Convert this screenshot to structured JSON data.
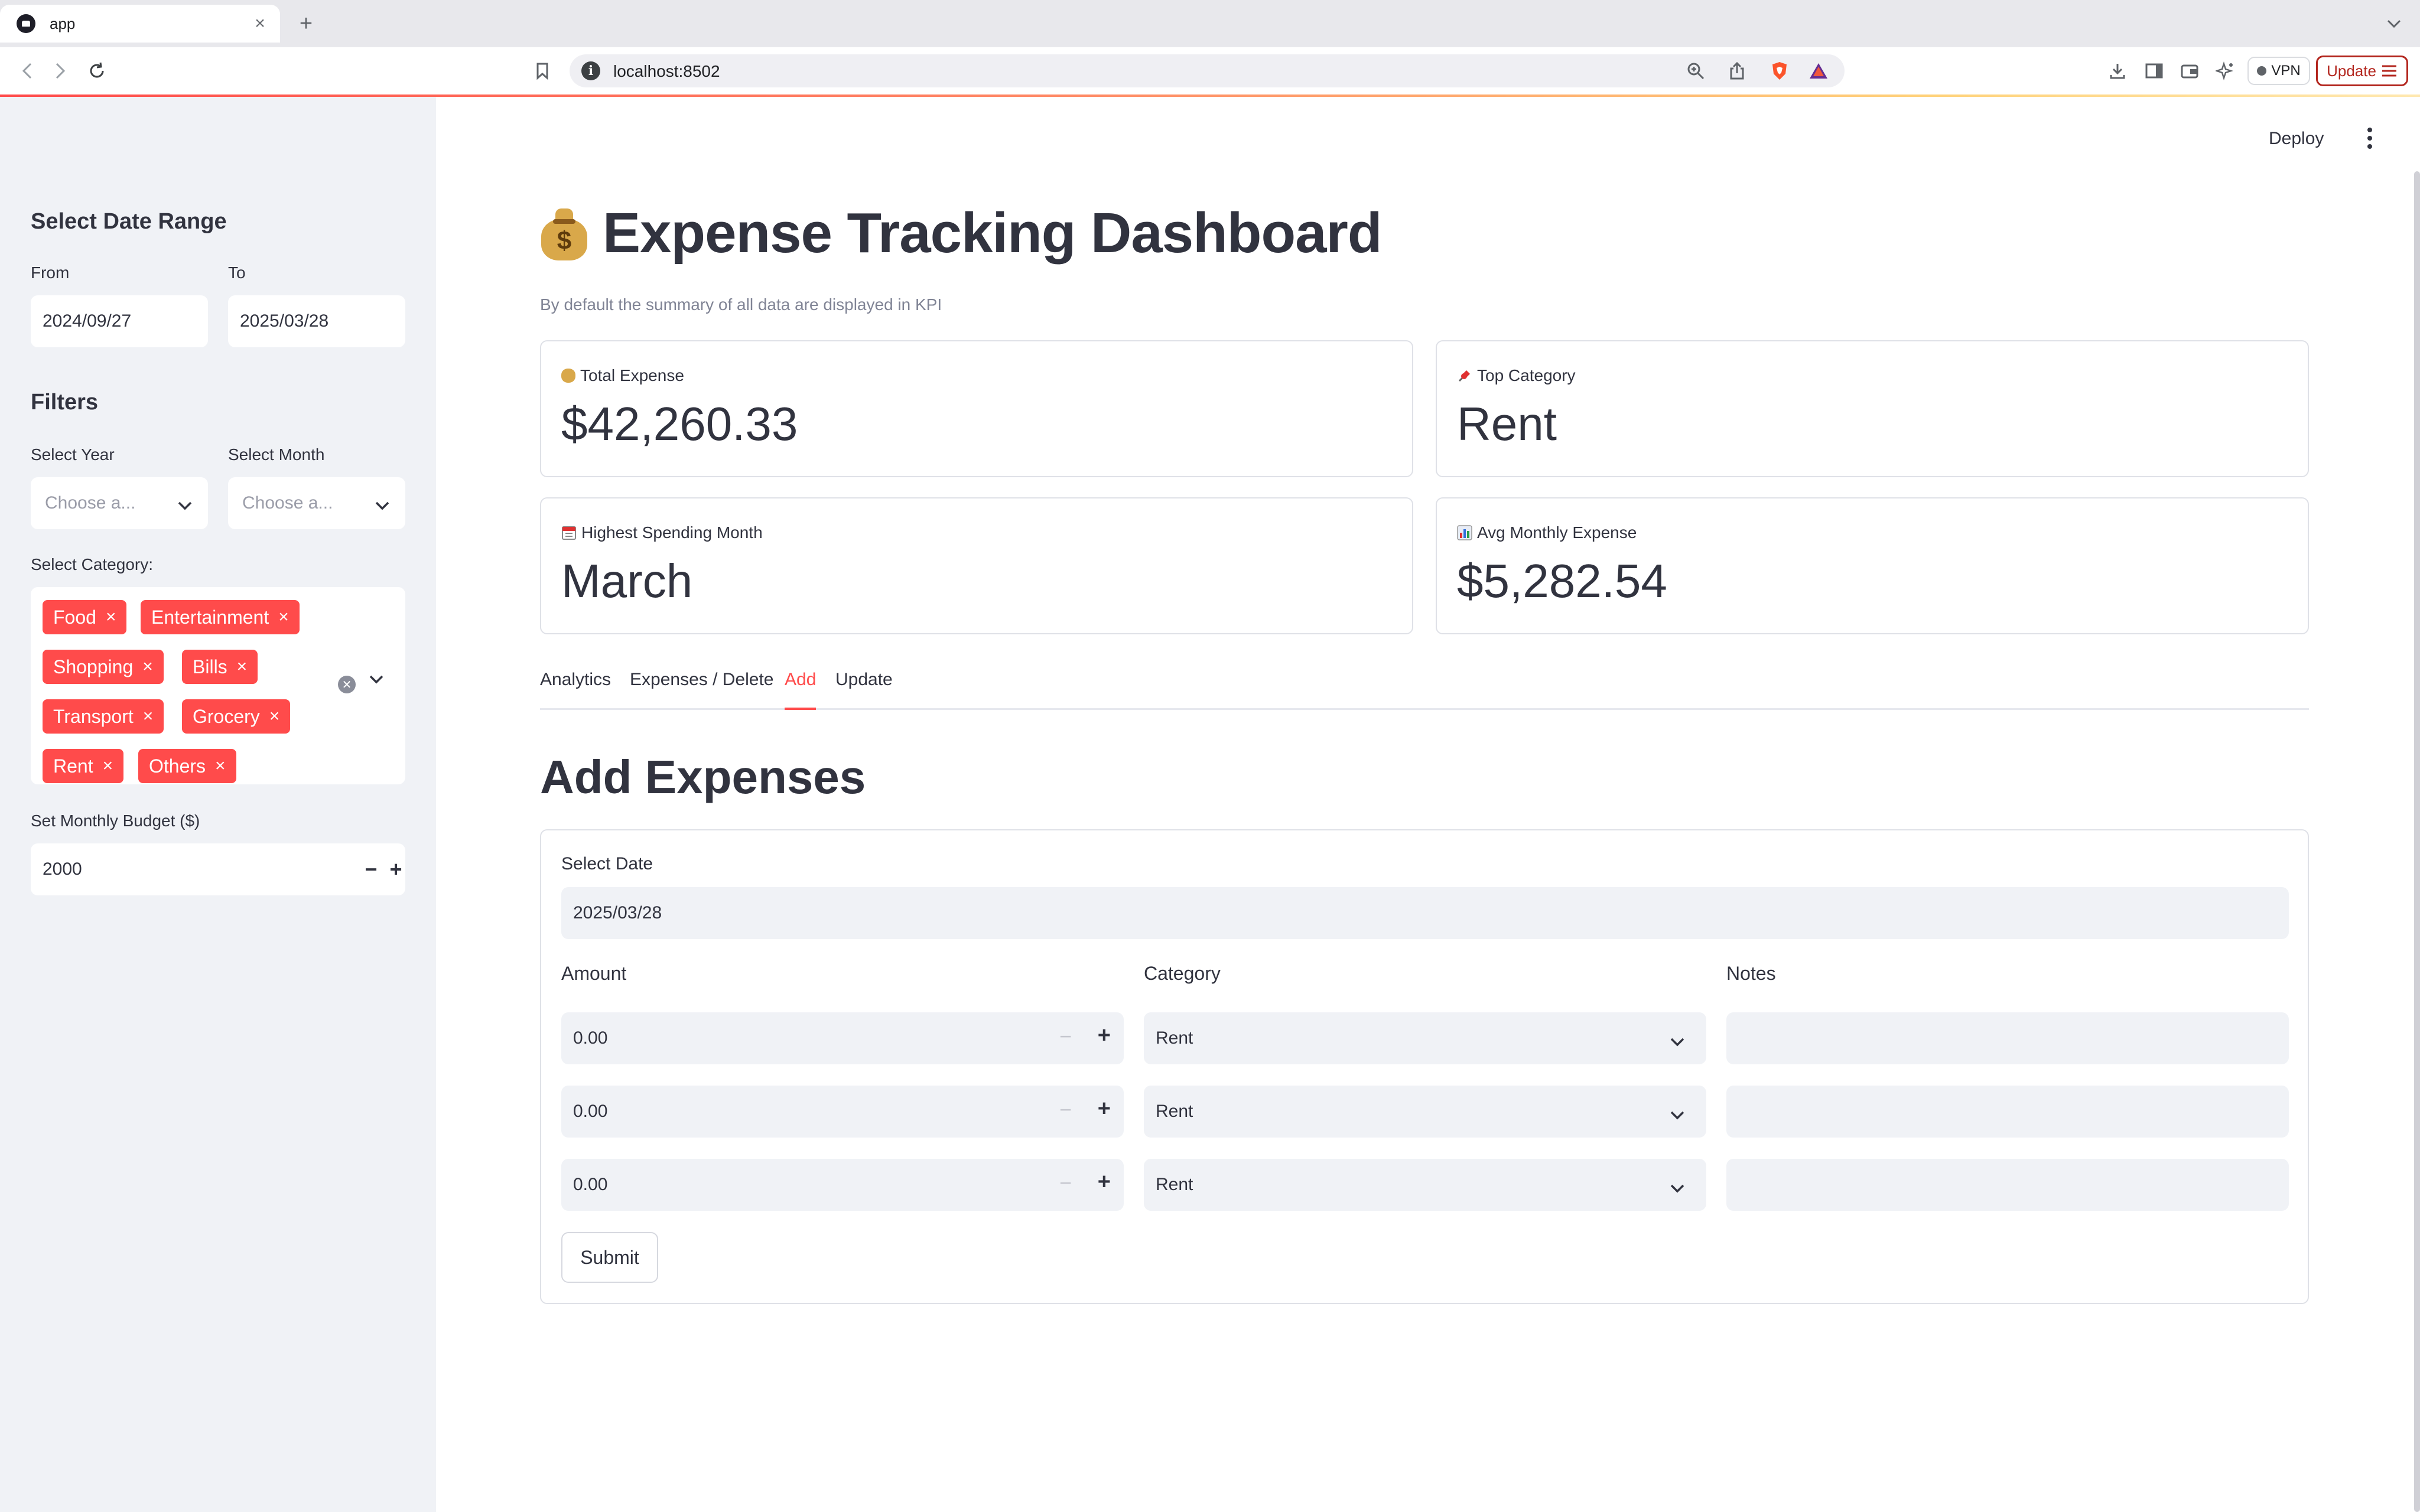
{
  "browser": {
    "tab_title": "app",
    "tab_close": "×",
    "new_tab": "+",
    "url": "localhost:8502",
    "vpn_label": "VPN",
    "update_label": "Update"
  },
  "sidebar": {
    "date_range_heading": "Select Date Range",
    "from_label": "From",
    "from_value": "2024/09/27",
    "to_label": "To",
    "to_value": "2025/03/28",
    "filters_heading": "Filters",
    "year_label": "Select Year",
    "year_placeholder": "Choose a...",
    "month_label": "Select Month",
    "month_placeholder": "Choose a...",
    "category_label": "Select Category:",
    "categories": [
      "Food",
      "Entertainment",
      "Shopping",
      "Bills",
      "Transport",
      "Grocery",
      "Rent",
      "Others"
    ],
    "chip_remove": "×",
    "budget_label": "Set Monthly Budget ($)",
    "budget_value": "2000",
    "minus": "−",
    "plus": "+"
  },
  "header": {
    "deploy_label": "Deploy"
  },
  "main": {
    "title": "Expense Tracking Dashboard",
    "caption": "By default the summary of all data are displayed in KPI",
    "kpis": [
      {
        "label": "Total Expense",
        "value": "$42,260.33",
        "icon": "money-bag-icon"
      },
      {
        "label": "Top Category",
        "value": "Rent",
        "icon": "pushpin-icon"
      },
      {
        "label": "Highest Spending Month",
        "value": "March",
        "icon": "calendar-icon"
      },
      {
        "label": "Avg Monthly Expense",
        "value": "$5,282.54",
        "icon": "bar-chart-icon"
      }
    ],
    "tabs": [
      "Analytics",
      "Expenses / Delete",
      "Add",
      "Update"
    ],
    "active_tab": "Add",
    "section_title": "Add Expenses",
    "form": {
      "date_label": "Select Date",
      "date_value": "2025/03/28",
      "amount_label": "Amount",
      "category_label": "Category",
      "notes_label": "Notes",
      "rows": [
        {
          "amount": "0.00",
          "category": "Rent",
          "notes": ""
        },
        {
          "amount": "0.00",
          "category": "Rent",
          "notes": ""
        },
        {
          "amount": "0.00",
          "category": "Rent",
          "notes": ""
        }
      ],
      "submit_label": "Submit"
    }
  },
  "colors": {
    "accent": "#ff4b4b",
    "sidebar_bg": "#f0f2f6",
    "text": "#31333f"
  }
}
